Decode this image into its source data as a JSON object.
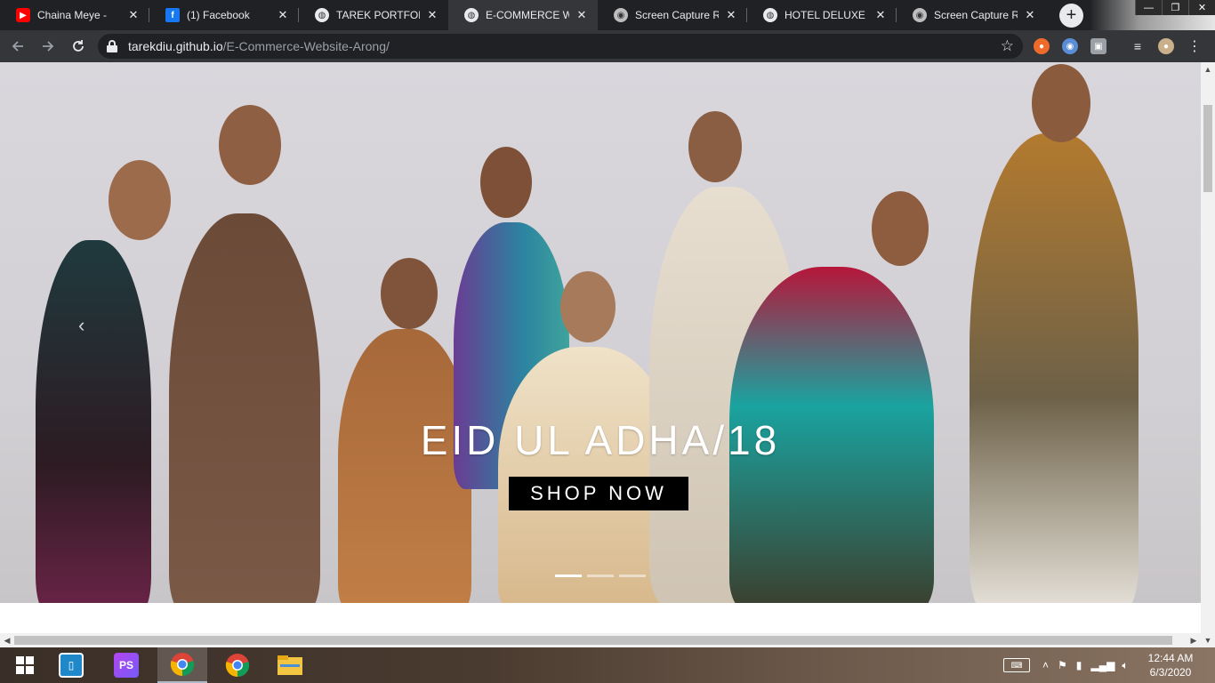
{
  "browser": {
    "tabs": [
      {
        "title": "Chaina Meye -",
        "icon": "youtube-icon",
        "color": "#ff0000"
      },
      {
        "title": "(1) Facebook",
        "icon": "facebook-icon",
        "color": "#1877f2"
      },
      {
        "title": "TAREK PORTFOLIO",
        "icon": "globe-icon",
        "color": "#e8eaed"
      },
      {
        "title": "E-COMMERCE WEB",
        "icon": "globe-icon",
        "color": "#e8eaed",
        "active": true
      },
      {
        "title": "Screen Capture Res",
        "icon": "capture-icon",
        "color": "#bdbdbd"
      },
      {
        "title": "HOTEL DELUXE",
        "icon": "globe-icon",
        "color": "#e8eaed"
      },
      {
        "title": "Screen Capture Res",
        "icon": "capture-icon",
        "color": "#bdbdbd"
      }
    ],
    "new_tab_glyph": "+",
    "close_glyph": "✕",
    "url_host": "tarekdiu.github.io",
    "url_path": "/E-Commerce-Website-Arong/",
    "window_controls": [
      "—",
      "❐",
      "✕"
    ]
  },
  "hero": {
    "title": "EID UL ADHA/18",
    "button_label": "SHOP NOW",
    "prev_glyph": "‹",
    "slide_count": 3,
    "active_slide": 1
  },
  "taskbar": {
    "apps": [
      {
        "name": "windows-start-icon"
      },
      {
        "name": "app-launcher-icon"
      },
      {
        "name": "phpstorm-icon",
        "label": "PS"
      },
      {
        "name": "chrome-icon",
        "active": true
      },
      {
        "name": "chrome-icon"
      },
      {
        "name": "file-explorer-icon"
      }
    ],
    "time": "12:44 AM",
    "date": "6/3/2020",
    "tray_up_glyph": "˄"
  },
  "colors": {
    "chrome_dark": "#202124",
    "chrome_toolbar": "#35363a",
    "hero_button_bg": "#000000",
    "hero_text": "#ffffff"
  }
}
